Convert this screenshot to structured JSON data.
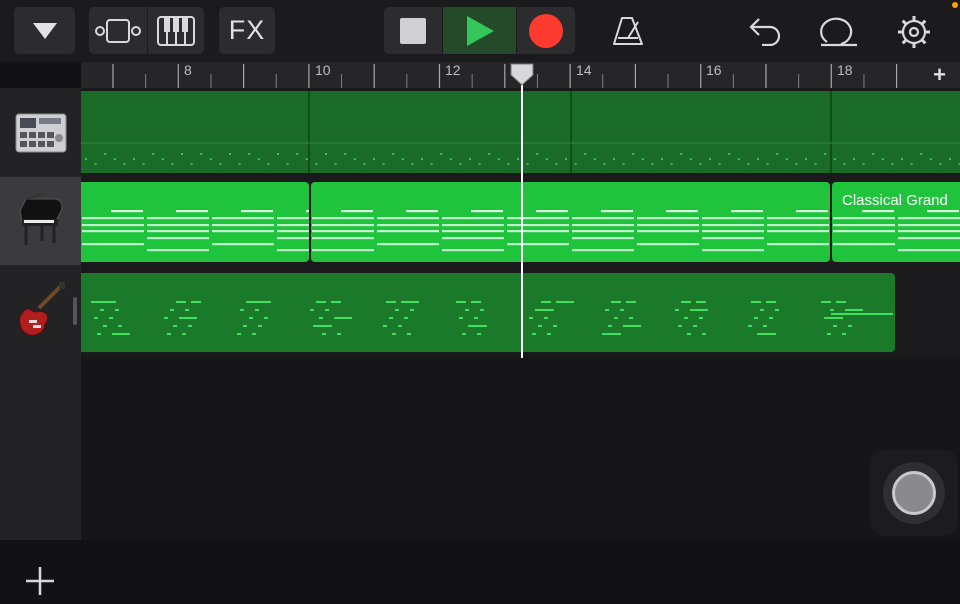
{
  "toolbar": {
    "fx_label": "FX",
    "colors": {
      "play": "#34c759",
      "record": "#ff3b30",
      "stop": "#d0d0d2"
    }
  },
  "ruler": {
    "bar_labels": [
      "8",
      "10",
      "12",
      "14",
      "16",
      "18"
    ],
    "add_label": "+"
  },
  "tracks": [
    {
      "instrument": "drum-machine",
      "regions": []
    },
    {
      "instrument": "grand-piano",
      "regions": [
        {
          "label": "Classical Grand"
        }
      ]
    },
    {
      "instrument": "electric-guitar",
      "regions": []
    }
  ],
  "colors": {
    "accent": "#1ec33b",
    "region_dim": "#1a7a2a",
    "note": "#34e05a"
  }
}
